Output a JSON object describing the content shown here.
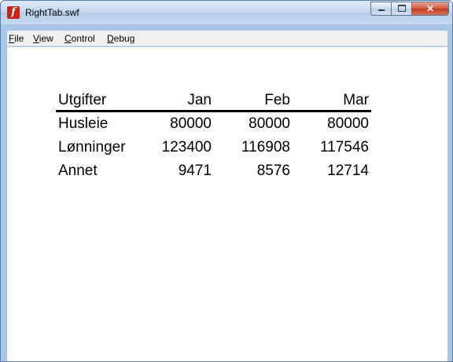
{
  "window": {
    "title": "RightTab.swf",
    "controls": {
      "minimize": "minimize",
      "maximize": "maximize",
      "close": "✕"
    }
  },
  "menu": [
    "File",
    "View",
    "Control",
    "Debug"
  ],
  "table": {
    "headers": [
      "Utgifter",
      "Jan",
      "Feb",
      "Mar"
    ],
    "rows": [
      [
        "Husleie",
        "80000",
        "80000",
        "80000"
      ],
      [
        "Lønninger",
        "123400",
        "116908",
        "117546"
      ],
      [
        "Annet",
        "9471",
        "8576",
        "12714"
      ]
    ]
  },
  "colors": {
    "titlebar": "#c6d9ef",
    "close_button": "#c0391d",
    "app_icon": "#c8231b"
  },
  "icons": {
    "app": "flash-player-icon"
  }
}
